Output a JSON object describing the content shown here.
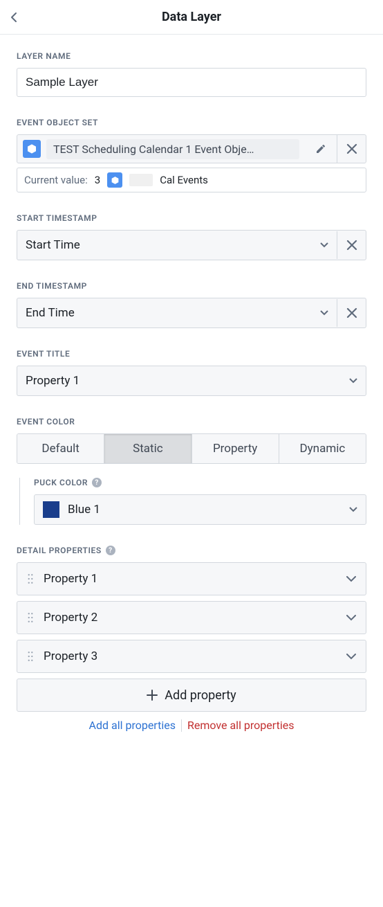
{
  "header": {
    "title": "Data Layer"
  },
  "layerName": {
    "label": "LAYER NAME",
    "value": "Sample Layer"
  },
  "eventObjectSet": {
    "label": "EVENT OBJECT SET",
    "chip": "TEST Scheduling Calendar 1 Event Obje…",
    "currentValueLabel": "Current value:",
    "currentValueCount": "3",
    "currentValueSuffix": "Cal Events"
  },
  "startTimestamp": {
    "label": "START TIMESTAMP",
    "value": "Start Time"
  },
  "endTimestamp": {
    "label": "END TIMESTAMP",
    "value": "End Time"
  },
  "eventTitle": {
    "label": "EVENT TITLE",
    "value": "Property 1"
  },
  "eventColor": {
    "label": "EVENT COLOR",
    "options": {
      "default": "Default",
      "static": "Static",
      "property": "Property",
      "dynamic": "Dynamic"
    },
    "puckColorLabel": "PUCK COLOR",
    "puckColorValue": "Blue 1"
  },
  "detailProperties": {
    "label": "DETAIL PROPERTIES",
    "items": [
      "Property 1",
      "Property 2",
      "Property 3"
    ],
    "addLabel": "Add property",
    "addAll": "Add all properties",
    "removeAll": "Remove all properties"
  }
}
